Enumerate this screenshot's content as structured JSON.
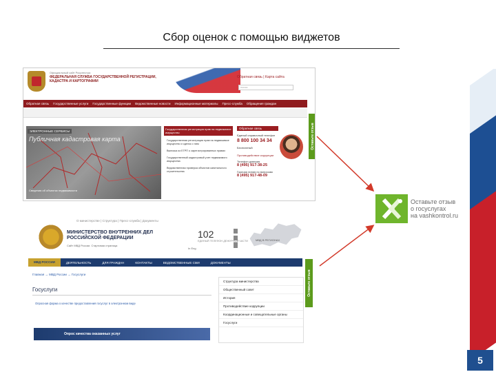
{
  "slide": {
    "title": "Сбор оценок с помощью виджетов",
    "page_number": "5"
  },
  "rosreestr": {
    "top_text": "Официальный сайт Росреестра",
    "org_name": "ФЕДЕРАЛЬНАЯ СЛУЖБА ГОСУДАРСТВЕННОЙ РЕГИСТРАЦИИ, КАДАСТРА И КАРТОГРАФИИ",
    "region": "РЕГИОН",
    "top_links": "Обратная связь | Карта сайта",
    "search_placeholder": "поиск",
    "nav": [
      "Обратная связь",
      "Государственные услуги",
      "Государственные функции",
      "Ведомственные новости",
      "Информационные материалы",
      "Пресс-служба",
      "Обращения граждан"
    ],
    "map_tag": "ЭЛЕКТРОННЫЕ СЕРВИСЫ",
    "map_title": "Публичная кадастровая карта",
    "map_caption": "Сведения об объектах недвижимости",
    "news_header": "Государственная регистрация прав на недвижимое имущество",
    "news_items": [
      "Государственная регистрация прав на недвижимое имущество и сделок с ним",
      "Выписка из ЕГРП о зарегистрированных правах",
      "Государственный кадастровый учет недвижимого имущества",
      "Ведомственная проверка объектов капитального строительства"
    ],
    "call_header": "Обратная связь",
    "call_text": "Единый справочный телефон",
    "phone": "8 800 100 34 34",
    "call_free": "Бесплатный",
    "anticorr": "Противодействие коррупции",
    "trust_label": "Телефон доверия",
    "trust_phone": "8 (495) 917-38-25",
    "hotline_label": "Горячая линия по вопросам",
    "hotline_phone": "8 (495) 917-48-09",
    "widget_label": "Оставьте отзыв"
  },
  "mvd": {
    "top_links": "О министерстве   |   Структура   |   Пресс-служба   |   Документы",
    "title_line1": "МИНИСТЕРСТВО ВНУТРЕННИХ ДЕЛ",
    "title_line2": "РОССИЙСКОЙ ФЕДЕРАЦИИ",
    "subtitle": "Сайт МВД России. Стартовая страница",
    "hotline": "102",
    "hotline_caption": "ЕДИНЫЙ ТЕЛЕФОН ДЕЖУРНОЙ ЧАСТИ",
    "map_label": "МВД В РЕГИОНАХ",
    "langs": "In Eng",
    "nav": [
      "МВД РОССИИ",
      "ДЕЯТЕЛЬНОСТЬ",
      "ДЛЯ ГРАЖДАН",
      "КОНТАКТЫ",
      "ВЕДОМСТВЕННЫЕ СМИ",
      "ДОКУМЕНТЫ"
    ],
    "breadcrumb": "Главная → МВД России → Госуслуги",
    "heading": "Госуслуги",
    "service_line": "Опросная форма о качестве предоставления госуслуг в электронном виде",
    "sidebar": [
      "Структура министерства",
      "Общественный совет",
      "История",
      "Противодействие коррупции",
      "Координационные и совещательные органы",
      "Госуслуги"
    ],
    "survey_label": "Опрос качества оказанных услуг",
    "widget_label": "Оставьте отзыв"
  },
  "vashkontrol": {
    "line1": "Оставьте отзыв",
    "line2": "о госуслугах",
    "line3": "на vashkontrol.ru",
    "brand_color": "#6fb52c"
  },
  "colors": {
    "rosreestr_red": "#8f1b1e",
    "mvd_blue": "#1d3b6e",
    "arrow_red": "#d23a2a",
    "page_num_bg": "#1f4f8f"
  }
}
